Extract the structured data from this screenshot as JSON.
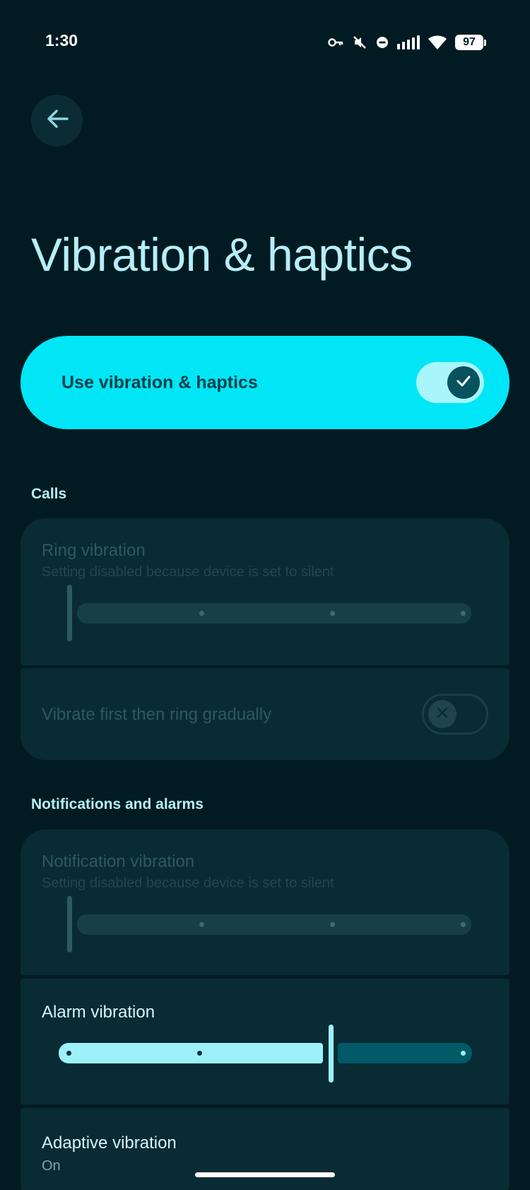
{
  "status_bar": {
    "time": "1:30",
    "battery": "97",
    "icons": [
      "key-icon",
      "vibrate-off-icon",
      "do-not-disturb-icon",
      "signal-icon",
      "wifi-icon",
      "battery-icon"
    ]
  },
  "header": {
    "back_icon": "arrow-back-icon",
    "title": "Vibration & haptics"
  },
  "master_toggle": {
    "label": "Use vibration & haptics",
    "checked": true
  },
  "sections": {
    "calls": {
      "header": "Calls",
      "ring_vibration": {
        "title": "Ring vibration",
        "subtitle": "Setting disabled because device is set to silent",
        "level": 0,
        "steps": 4,
        "enabled": false
      },
      "vibrate_first": {
        "label": "Vibrate first then ring gradually",
        "checked": false,
        "enabled": false
      }
    },
    "notifications": {
      "header": "Notifications and alarms",
      "notification_vibration": {
        "title": "Notification vibration",
        "subtitle": "Setting disabled because device is set to silent",
        "level": 0,
        "steps": 4,
        "enabled": false
      },
      "alarm_vibration": {
        "title": "Alarm vibration",
        "level": 2,
        "steps": 4,
        "enabled": true
      },
      "adaptive_vibration": {
        "title": "Adaptive vibration",
        "value": "On"
      }
    }
  },
  "colors": {
    "background": "#021b22",
    "accent": "#00e6f6",
    "card": "#082b34",
    "title": "#b6eef8"
  }
}
